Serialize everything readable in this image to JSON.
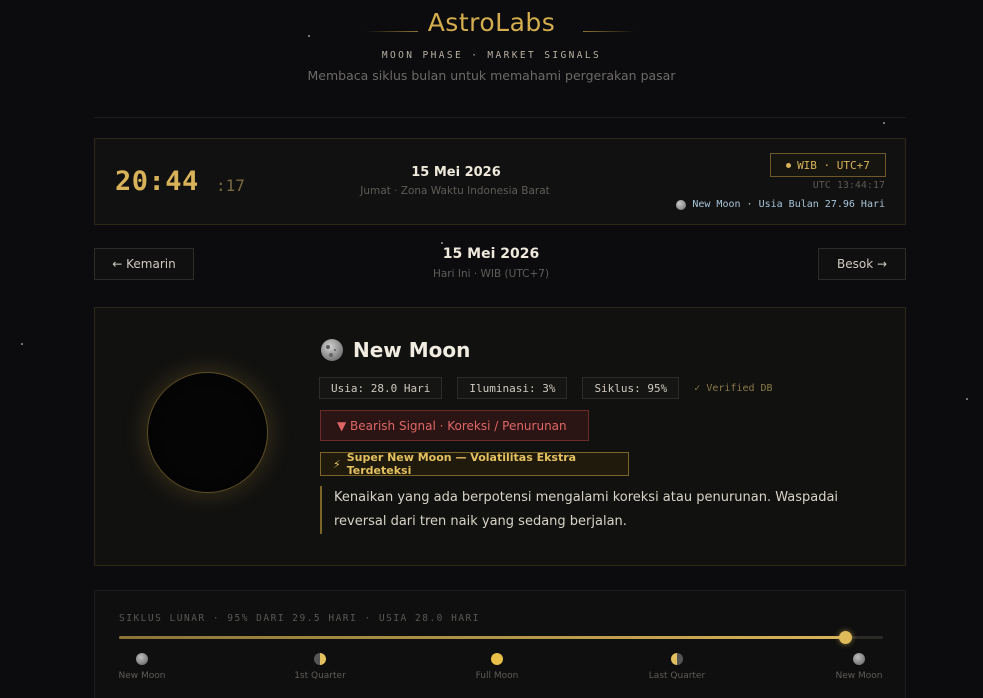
{
  "header": {
    "brand": "AstroLabs",
    "tagline": "MOON PHASE · MARKET SIGNALS",
    "subtitle": "Membaca siklus bulan untuk memahami pergerakan pasar"
  },
  "clock": {
    "time": "20:44",
    "seconds": ":17",
    "date": "15 Mei 2026",
    "day_zone": "Jumat · Zona Waktu Indonesia Barat",
    "tz_badge": "WIB · UTC+7",
    "utc": "UTC 13:44:17",
    "moon_info": "New Moon · Usia Bulan 27.96 Hari"
  },
  "nav": {
    "prev_label": "← Kemarin",
    "next_label": "Besok →",
    "date": "15 Mei 2026",
    "sub": "Hari Ini · WIB (UTC+7)"
  },
  "phase": {
    "name": "New Moon",
    "stats": [
      "Usia: 28.0 Hari",
      "Iluminasi: 3%",
      "Siklus: 95%"
    ],
    "verified": "✓ Verified DB",
    "signal": "▼ Bearish Signal · Koreksi / Penurunan",
    "super": "Super New Moon — Volatilitas Ekstra Terdeteksi",
    "description": "Kenaikan yang ada berpotensi mengalami koreksi atau penurunan. Waspadai reversal dari tren naik yang sedang berjalan."
  },
  "cycle": {
    "label": "SIKLUS LUNAR · 95% DARI 29.5 HARI · USIA 28.0 HARI",
    "progress": 0.95,
    "milestones": [
      "New Moon",
      "1st Quarter",
      "Full Moon",
      "Last Quarter",
      "New Moon"
    ]
  },
  "colors": {
    "accent": "#d8b35a",
    "bearish": "#e06666",
    "background": "#0c0c0f"
  }
}
